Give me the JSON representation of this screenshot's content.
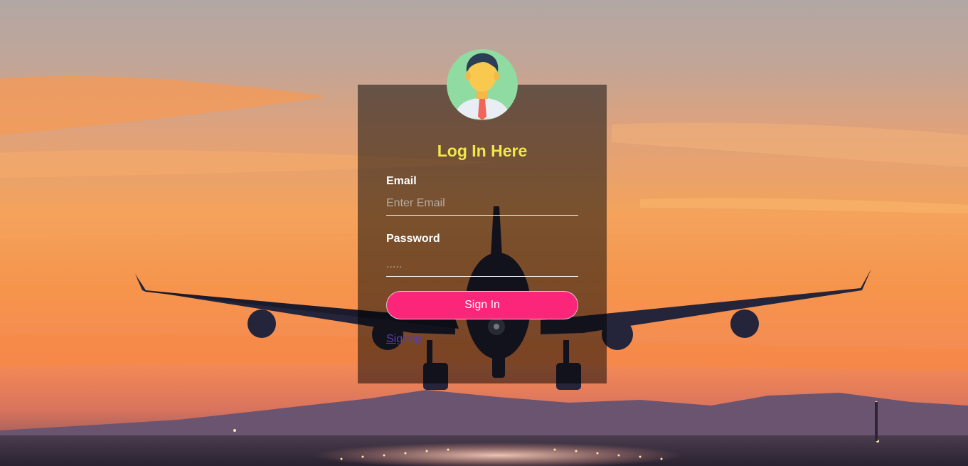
{
  "login": {
    "title": "Log In Here",
    "email_label": "Email",
    "email_placeholder": "Enter Email",
    "password_label": "Password",
    "password_placeholder": ".....",
    "signin_label": "Sign In",
    "signup_label": "Signup"
  },
  "colors": {
    "title": "#f0e84a",
    "button": "#fb2579",
    "link": "#5a3fa8",
    "panel": "rgba(0,0,0,0.5)"
  }
}
